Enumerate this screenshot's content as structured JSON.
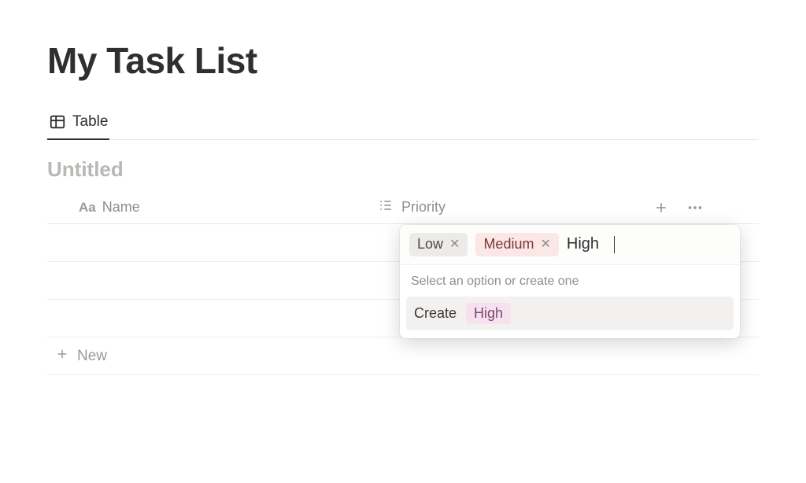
{
  "page": {
    "title": "My Task List"
  },
  "tabs": {
    "active": {
      "label": "Table"
    }
  },
  "database": {
    "title": "Untitled",
    "columns": {
      "name": {
        "label": "Name"
      },
      "priority": {
        "label": "Priority"
      }
    },
    "new_row_label": "New"
  },
  "popover": {
    "selected": [
      {
        "label": "Low",
        "color": "gray"
      },
      {
        "label": "Medium",
        "color": "red"
      }
    ],
    "input_value": "High",
    "hint": "Select an option or create one",
    "create_label": "Create",
    "create_tag": {
      "label": "High",
      "color": "pink"
    }
  }
}
